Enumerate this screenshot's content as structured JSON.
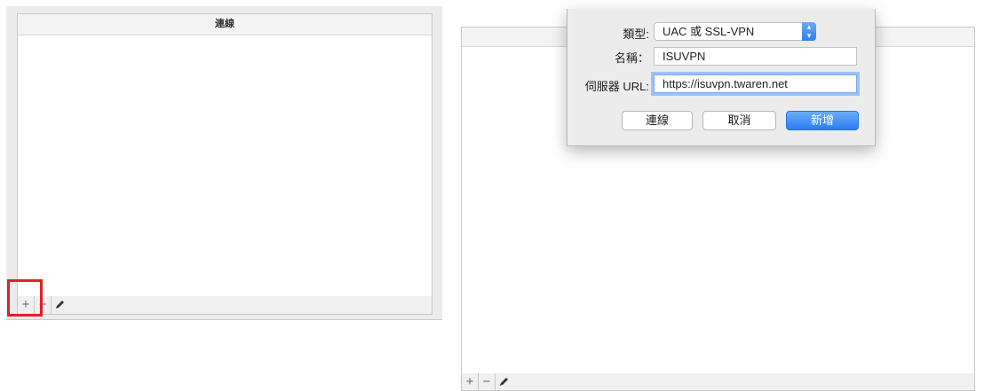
{
  "left_panel": {
    "column_header": "連線",
    "toolbar": {
      "add": "+",
      "remove": "−"
    }
  },
  "right_panel": {
    "column_header": "",
    "toolbar": {
      "add": "+",
      "remove": "−"
    }
  },
  "dialog": {
    "type_label": "類型:",
    "type_value": "UAC 或 SSL-VPN",
    "name_label": "名稱：",
    "name_value": "ISUVPN",
    "url_label": "伺服器 URL:",
    "url_value": "https://isuvpn.twaren.net",
    "buttons": {
      "connect": "連線",
      "cancel": "取消",
      "add": "新增"
    }
  },
  "colors": {
    "accent": "#2b7cf0",
    "highlight": "#e21f26"
  }
}
